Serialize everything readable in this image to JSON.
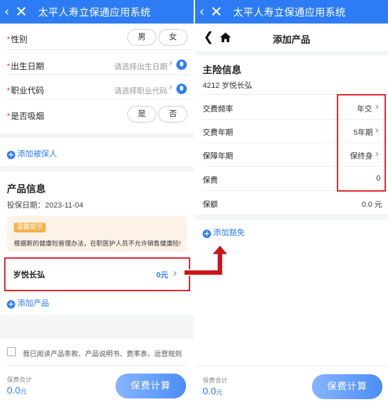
{
  "app": {
    "title": "太平人寿立保通应用系统"
  },
  "left": {
    "insured_fields": [
      {
        "required": "*",
        "label": "性别",
        "options": [
          "男",
          "女"
        ]
      },
      {
        "required": "*",
        "label": "出生日期",
        "placeholder": "请选择出生日期"
      },
      {
        "required": "*",
        "label": "职业代码",
        "placeholder": "请选择职业代码"
      },
      {
        "required": "*",
        "label": "是否吸烟",
        "options": [
          "是",
          "否"
        ]
      }
    ],
    "add_insured_label": "添加被保人",
    "product_section": {
      "title": "产品信息",
      "date_label": "投保日期：",
      "date_value": "2023-11-04",
      "tip_badge": "温馨提示",
      "tip_text": "根据新的健康险管理办法，在职医护人员不允许销售健康险!",
      "product_name": "岁悦长弘",
      "product_amount": "0元",
      "add_product_label": "添加产品"
    },
    "agreement_text": "我已阅读产品条款、产品说明书、费率表、运营规则",
    "footer": {
      "total_label": "保费合计",
      "total_value": "0.0",
      "total_unit": "元",
      "calc_button": "保费计算"
    }
  },
  "right": {
    "nav_title": "添加产品",
    "main_section_title": "主险信息",
    "product_code_name": "4212 岁悦长弘",
    "rows": [
      {
        "label": "交费频率",
        "value": "年交",
        "has_arrow": true
      },
      {
        "label": "交费年期",
        "value": "5年期",
        "has_arrow": true
      },
      {
        "label": "保障年期",
        "value": "保终身",
        "has_arrow": true
      },
      {
        "label": "保费",
        "value": "0",
        "has_arrow": false
      },
      {
        "label": "保额",
        "value": "0.0 元",
        "has_arrow": false
      }
    ],
    "add_rider_label": "添加豁免",
    "footer": {
      "total_label": "保费合计",
      "total_value": "0.0",
      "total_unit": "元",
      "calc_button": "保费计算"
    }
  },
  "colors": {
    "header_blue": "#2d7cf4",
    "highlight_red": "#e0232a",
    "required_red": "#e83b3b",
    "tip_bg": "#fdf2e7"
  },
  "icons": {
    "back": "chevron-left-icon",
    "close": "close-icon",
    "home": "home-icon",
    "mic": "mic-icon",
    "add": "plus-circle-icon",
    "arrow": "red-arrow-icon"
  }
}
